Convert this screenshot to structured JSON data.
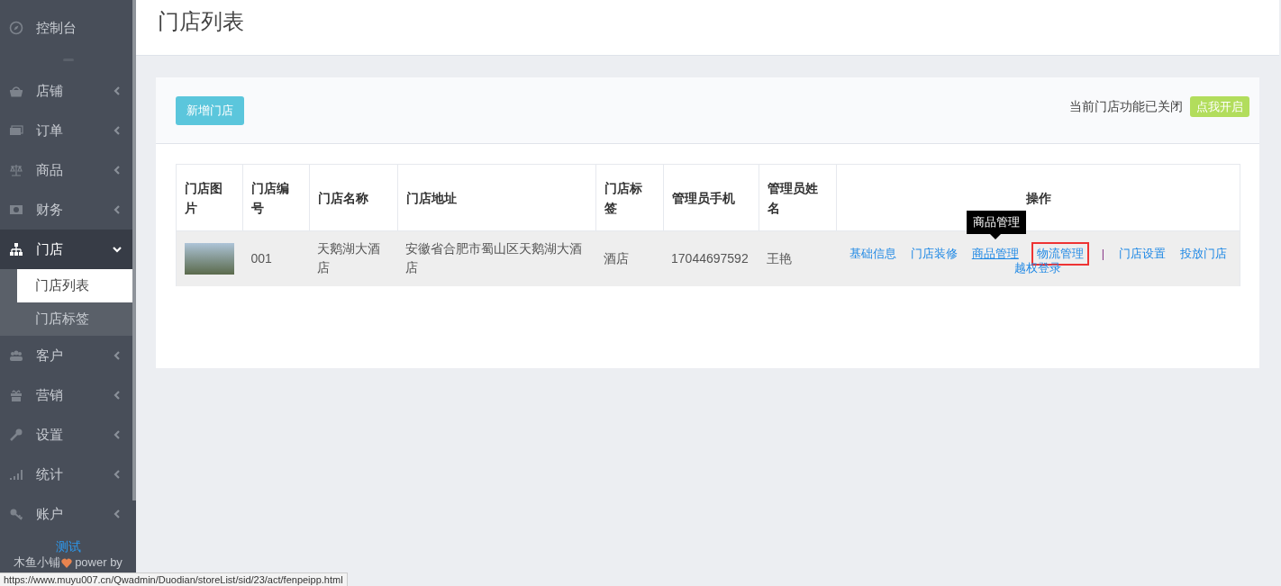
{
  "sidebar": {
    "items": [
      {
        "label": "控制台",
        "has_caret": false,
        "selected": false
      },
      {
        "label": "店铺",
        "has_caret": true,
        "expanded": false,
        "selected": false
      },
      {
        "label": "订单",
        "has_caret": true,
        "expanded": false,
        "selected": false
      },
      {
        "label": "商品",
        "has_caret": true,
        "expanded": false,
        "selected": false
      },
      {
        "label": "财务",
        "has_caret": true,
        "expanded": false,
        "selected": false
      },
      {
        "label": "门店",
        "has_caret": true,
        "expanded": true,
        "selected": true,
        "children": [
          {
            "label": "门店列表",
            "selected": true
          },
          {
            "label": "门店标签",
            "selected": false
          }
        ]
      },
      {
        "label": "客户",
        "has_caret": true,
        "expanded": false,
        "selected": false
      },
      {
        "label": "营销",
        "has_caret": true,
        "expanded": false,
        "selected": false
      },
      {
        "label": "设置",
        "has_caret": true,
        "expanded": false,
        "selected": false
      },
      {
        "label": "统计",
        "has_caret": true,
        "expanded": false,
        "selected": false
      },
      {
        "label": "账户",
        "has_caret": true,
        "expanded": false,
        "selected": false
      }
    ],
    "footer_link": "测试",
    "footer_brand": "木鱼小铺",
    "footer_power": "power by"
  },
  "page": {
    "title": "门店列表"
  },
  "toolbar": {
    "add_button": "新增门店",
    "status_text": "当前门店功能已关闭",
    "enable_button": "点我开启"
  },
  "table": {
    "columns": [
      "门店图片",
      "门店编号",
      "门店名称",
      "门店地址",
      "门店标签",
      "管理员手机",
      "管理员姓名",
      "操作"
    ],
    "rows": [
      {
        "code": "001",
        "name": "天鹅湖大酒店",
        "address": "安徽省合肥市蜀山区天鹅湖大酒店",
        "tag": "酒店",
        "phone": "17044697592",
        "manager": "王艳",
        "actions": [
          {
            "kind": "link",
            "label": "基础信息",
            "hovered": false,
            "highlighted": false
          },
          {
            "kind": "link",
            "label": "门店装修",
            "hovered": false,
            "highlighted": false
          },
          {
            "kind": "link",
            "label": "商品管理",
            "hovered": true,
            "highlighted": false
          },
          {
            "kind": "link",
            "label": "物流管理",
            "hovered": false,
            "highlighted": true
          },
          {
            "kind": "separator",
            "label": "|"
          },
          {
            "kind": "link",
            "label": "门店设置",
            "hovered": false,
            "highlighted": false
          },
          {
            "kind": "link",
            "label": "投放门店",
            "hovered": false,
            "highlighted": false
          },
          {
            "kind": "link",
            "label": "越权登录",
            "hovered": false,
            "highlighted": false
          }
        ]
      }
    ]
  },
  "tooltip": "商品管理",
  "status_bar": {
    "url": "https://www.muyu007.cn/Qwadmin/Duodian/storeList/sid/23/act/fenpeipp.html"
  }
}
